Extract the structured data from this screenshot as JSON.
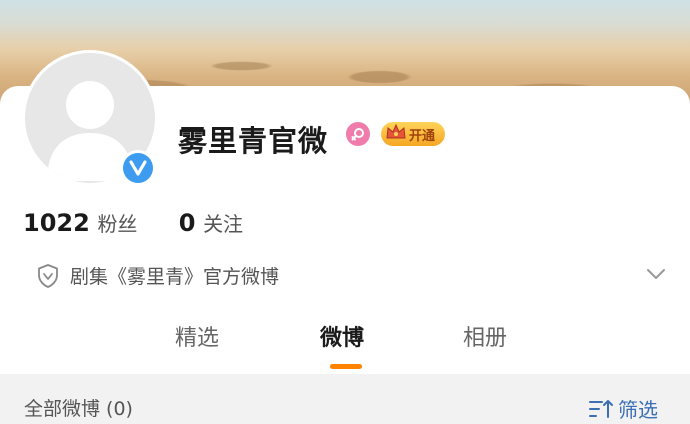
{
  "profile": {
    "name": "雾里青官微",
    "vip_label": "开通",
    "followers_count": "1022",
    "followers_label": "粉丝",
    "following_count": "0",
    "following_label": "关注",
    "description": "剧集《雾里青》官方微博"
  },
  "tabs": [
    {
      "label": "精选",
      "active": false
    },
    {
      "label": "微博",
      "active": true
    },
    {
      "label": "相册",
      "active": false
    }
  ],
  "filter": {
    "all_label": "全部微博 (0)",
    "filter_label": "筛选"
  },
  "colors": {
    "accent": "#ff8200",
    "verified": "#3d9cf0",
    "gender_female": "#f07cab",
    "link": "#3a6fb5"
  }
}
